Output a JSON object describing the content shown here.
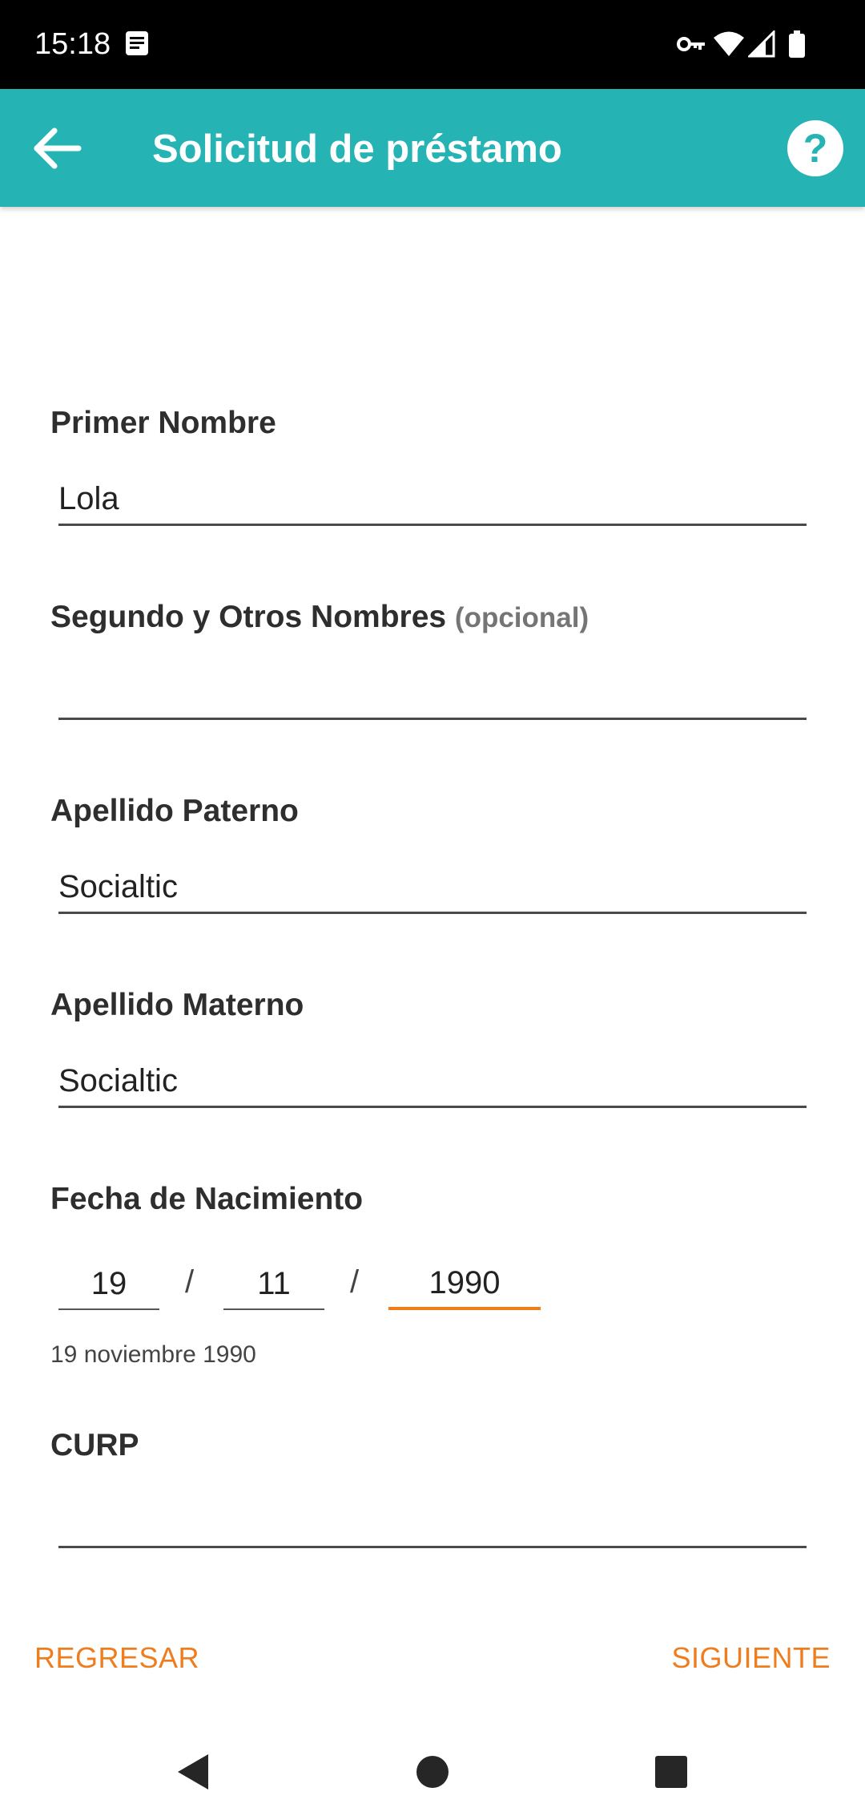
{
  "status_bar": {
    "time": "15:18",
    "icons": [
      "notification-icon",
      "vpn-key-icon",
      "wifi-icon",
      "signal-icon",
      "battery-icon"
    ]
  },
  "app_bar": {
    "title": "Solicitud de préstamo",
    "background_color": "#26b3b4",
    "back_icon": "arrow-left-icon",
    "help_icon": "help-circle-icon"
  },
  "form": {
    "first_name": {
      "label": "Primer Nombre",
      "value": "Lola"
    },
    "middle_names": {
      "label": "Segundo y Otros Nombres",
      "optional_tag": "(opcional)",
      "value": ""
    },
    "paternal_surname": {
      "label": "Apellido Paterno",
      "value": "Socialtic"
    },
    "maternal_surname": {
      "label": "Apellido Materno",
      "value": "Socialtic"
    },
    "birth_date": {
      "label": "Fecha de Nacimiento",
      "day": "19",
      "month": "11",
      "year": "1990",
      "separator": "/",
      "hint": "19 noviembre 1990"
    },
    "curp": {
      "label": "CURP",
      "value": ""
    }
  },
  "footer": {
    "back_label": "REGRESAR",
    "next_label": "SIGUIENTE",
    "accent_color": "#ef7d1e"
  },
  "system_nav": {
    "icons": [
      "back-triangle-icon",
      "home-circle-icon",
      "recents-square-icon"
    ]
  }
}
